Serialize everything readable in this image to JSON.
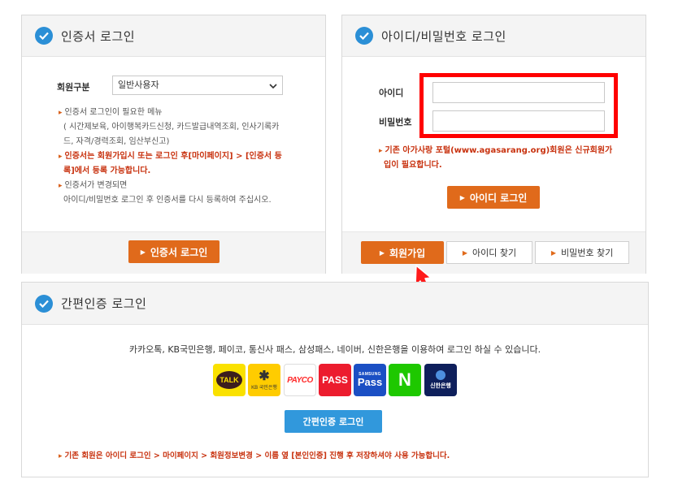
{
  "cert_login": {
    "title": "인증서 로그인",
    "member_type_label": "회원구분",
    "member_type_selected": "일반사용자",
    "note1_line1": "인증서 로그인이 필요한 메뉴",
    "note1_line2": "( 시간제보육, 아이행복카드신청, 카드발급내역조회, 인사기록카",
    "note1_line3": "드, 자격/경력조회, 임산부신고)",
    "note2_line1": "인증서는 회원가입시 또는 로그인 후[마이페이지] > [인증서 등",
    "note2_line2": "록]에서 등록 가능합니다.",
    "note3_line1": "인증서가 변경되면",
    "note3_line2": "아이디/비밀번호 로그인 후 인증서를 다시 등록하여 주십시오.",
    "login_button": "인증서 로그인"
  },
  "id_login": {
    "title": "아이디/비밀번호 로그인",
    "id_label": "아이디",
    "pw_label": "비밀번호",
    "id_value": "",
    "pw_value": "",
    "note_line1": "기존 아가사랑 포털(www.agasarang.org)회원은 신규회원가",
    "note_line2": "입이 필요합니다.",
    "login_button": "아이디 로그인",
    "signup_button": "회원가입",
    "find_id_button": "아이디 찾기",
    "find_pw_button": "비밀번호 찾기",
    "highlight_color": "#ff0000"
  },
  "simple_login": {
    "title": "간편인증 로그인",
    "description": "카카오톡, KB국민은행, 페이코, 통신사 패스, 삼성패스, 네이버, 신한은행을 이용하여 로그인 하실 수 있습니다.",
    "providers": [
      {
        "name": "kakaotalk",
        "label": "TALK"
      },
      {
        "name": "kb-bank",
        "label": "KB 국민은행"
      },
      {
        "name": "payco",
        "label": "PAYCO"
      },
      {
        "name": "pass",
        "label": "PASS"
      },
      {
        "name": "samsung-pass",
        "label_top": "SAMSUNG",
        "label": "Pass"
      },
      {
        "name": "naver",
        "label": "N"
      },
      {
        "name": "shinhan-bank",
        "label": "신한은행"
      }
    ],
    "login_button": "간편인증 로그인",
    "footer_note": "기존 회원은 아이디 로그인 > 마이페이지 > 회원정보변경 > 이름 옆 [본인인증] 진행 후 저장하셔야 사용 가능합니다."
  },
  "colors": {
    "accent_orange": "#e06a1b",
    "accent_blue": "#2b8fd6",
    "note_red": "#c8320f"
  }
}
